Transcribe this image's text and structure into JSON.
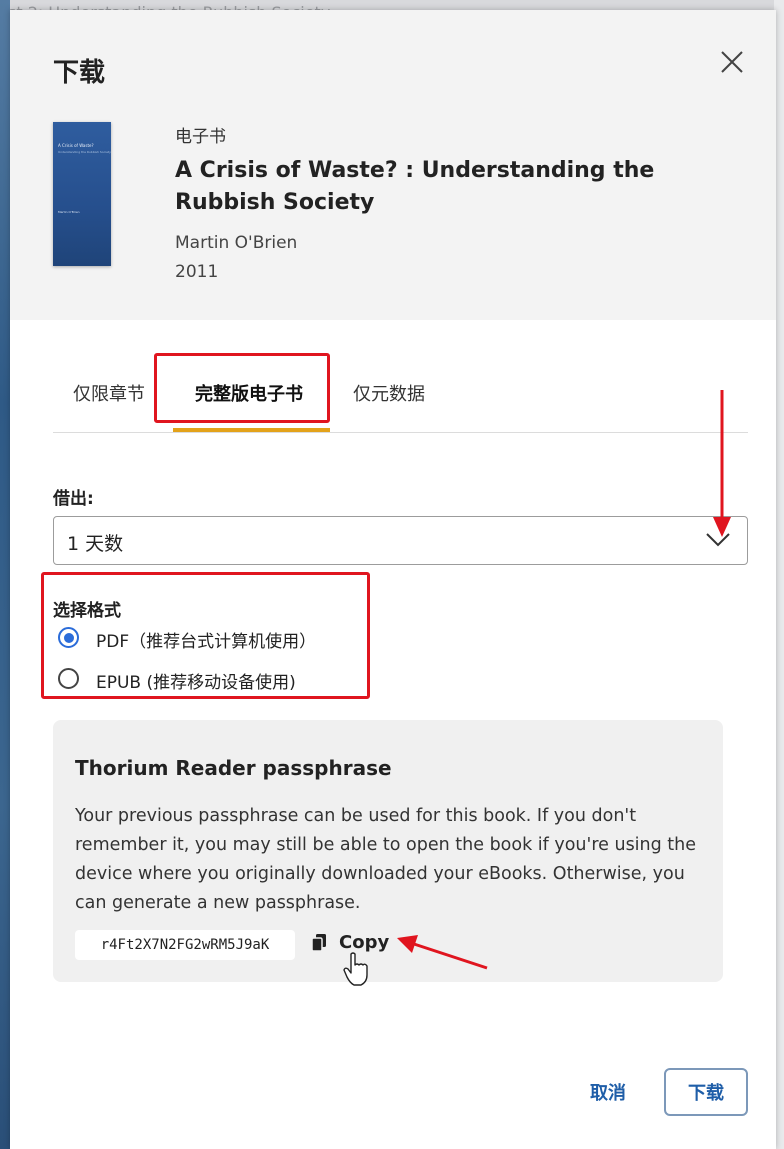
{
  "background": {
    "title_fragment": "st 2: Understanding the Rubbish Society"
  },
  "dialog": {
    "title": "下载",
    "close_icon": "close-icon"
  },
  "book": {
    "type": "电子书",
    "title": "A Crisis of Waste? : Understanding the Rubbish Society",
    "author": "Martin O'Brien",
    "year": "2011",
    "cover": {
      "title": "A Crisis of Waste?",
      "subtitle": "Understanding the Rubbish Society",
      "author": "Martin O'Brien"
    }
  },
  "tabs": [
    {
      "label": "仅限章节",
      "active": false
    },
    {
      "label": "完整版电子书",
      "active": true
    },
    {
      "label": "仅元数据",
      "active": false
    }
  ],
  "loan": {
    "label": "借出:",
    "value": "1 天数"
  },
  "format": {
    "label": "选择格式",
    "options": [
      {
        "label": "PDF（推荐台式计算机使用）",
        "selected": true
      },
      {
        "label": "EPUB (推荐移动设备使用)",
        "selected": false
      }
    ]
  },
  "passphrase": {
    "title": "Thorium Reader passphrase",
    "description": "Your previous passphrase can be used for this book. If you don't remember it, you may still be able to open the book if you're using the device where you originally downloaded your eBooks. Otherwise, you can generate a new passphrase.",
    "code": "r4Ft2X7N2FG2wRM5J9aK",
    "copy_label": "Copy"
  },
  "actions": {
    "cancel_label": "取消",
    "download_label": "下载"
  },
  "colors": {
    "accent_blue": "#2b6cd9",
    "tab_underline": "#e3a21a",
    "annotation_red": "#e0151f",
    "action_text": "#1f5ea8"
  }
}
